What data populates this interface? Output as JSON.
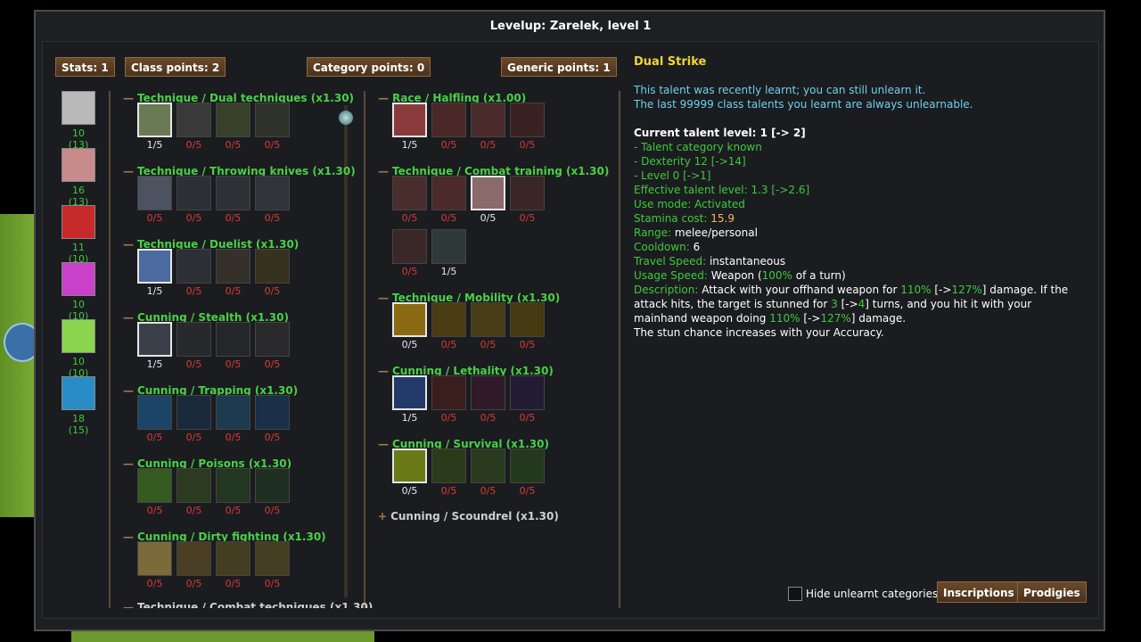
{
  "window": {
    "title": "Levelup: Zarelek, level 1"
  },
  "points": {
    "stats": "Stats: 1",
    "class": "Class points: 2",
    "category": "Category points: 0",
    "generic": "Generic points: 1"
  },
  "stats": [
    {
      "name": "strength-icon",
      "value": "10 (13)",
      "color": "#b9b9b9"
    },
    {
      "name": "dexterity-icon",
      "value": "16 (13)",
      "color": "#c78b8b"
    },
    {
      "name": "constitution-icon",
      "value": "11 (10)",
      "color": "#c62a2a"
    },
    {
      "name": "magic-icon",
      "value": "10 (10)",
      "color": "#c940c9"
    },
    {
      "name": "willpower-icon",
      "value": "10 (10)",
      "color": "#8bd450"
    },
    {
      "name": "cunning-icon",
      "value": "18 (15)",
      "color": "#2a8cc6"
    }
  ],
  "left_categories": [
    {
      "name": "Technique / Dual techniques (x1.30)",
      "talents": [
        {
          "icon": "dual-strike-icon",
          "value": "1/5",
          "learned": true,
          "color": "#6a7a54"
        },
        {
          "icon": "flurry-icon",
          "value": "0/5",
          "learned": false,
          "color": "#3a3a3a"
        },
        {
          "icon": "sweep-icon",
          "value": "0/5",
          "learned": false,
          "color": "#38402a"
        },
        {
          "icon": "whirlwind-icon",
          "value": "0/5",
          "learned": false,
          "color": "#2f332a"
        }
      ]
    },
    {
      "name": "Technique / Throwing knives (x1.30)",
      "talents": [
        {
          "icon": "throwing-knife-icon",
          "value": "0/5",
          "learned": false,
          "color": "#4c5260"
        },
        {
          "icon": "fan-of-knives-icon",
          "value": "0/5",
          "learned": false,
          "color": "#2d2f36"
        },
        {
          "icon": "venom-knife-icon",
          "value": "0/5",
          "learned": false,
          "color": "#2e3136"
        },
        {
          "icon": "knife-storm-icon",
          "value": "0/5",
          "learned": false,
          "color": "#30333a"
        }
      ]
    },
    {
      "name": "Technique / Duelist (x1.30)",
      "talents": [
        {
          "icon": "parry-icon",
          "value": "1/5",
          "learned": true,
          "color": "#4a6aa0"
        },
        {
          "icon": "tempo-icon",
          "value": "0/5",
          "learned": false,
          "color": "#2d2f36"
        },
        {
          "icon": "feint-icon",
          "value": "0/5",
          "learned": false,
          "color": "#35302a"
        },
        {
          "icon": "lunge-icon",
          "value": "0/5",
          "learned": false,
          "color": "#36321f"
        }
      ]
    },
    {
      "name": "Cunning / Stealth (x1.30)",
      "talents": [
        {
          "icon": "stealth-icon",
          "value": "1/5",
          "learned": true,
          "color": "#3a3f4a"
        },
        {
          "icon": "shadowstrike-icon",
          "value": "0/5",
          "learned": false,
          "color": "#27292d"
        },
        {
          "icon": "hide-in-plain-sight-icon",
          "value": "0/5",
          "learned": false,
          "color": "#26272a"
        },
        {
          "icon": "unseen-actions-icon",
          "value": "0/5",
          "learned": false,
          "color": "#2a2a2c"
        }
      ]
    },
    {
      "name": "Cunning / Trapping (x1.30)",
      "talents": [
        {
          "icon": "trap-mastery-icon",
          "value": "0/5",
          "learned": false,
          "color": "#1c4466"
        },
        {
          "icon": "lure-icon",
          "value": "0/5",
          "learned": false,
          "color": "#1a2a3a"
        },
        {
          "icon": "advanced-trap-icon",
          "value": "0/5",
          "learned": false,
          "color": "#1e3a4f"
        },
        {
          "icon": "trap-launcher-icon",
          "value": "0/5",
          "learned": false,
          "color": "#1a2f48"
        }
      ]
    },
    {
      "name": "Cunning / Poisons (x1.30)",
      "talents": [
        {
          "icon": "apply-poison-icon",
          "value": "0/5",
          "learned": false,
          "color": "#355a20"
        },
        {
          "icon": "toxic-death-icon",
          "value": "0/5",
          "learned": false,
          "color": "#2d3a22"
        },
        {
          "icon": "vile-poisons-icon",
          "value": "0/5",
          "learned": false,
          "color": "#223622"
        },
        {
          "icon": "venomous-strike-icon",
          "value": "0/5",
          "learned": false,
          "color": "#1f2f22"
        }
      ]
    },
    {
      "name": "Cunning / Dirty fighting (x1.30)",
      "talents": [
        {
          "icon": "dirty-fighting-icon",
          "value": "0/5",
          "learned": false,
          "color": "#7b6a3a"
        },
        {
          "icon": "cripple-icon",
          "value": "0/5",
          "learned": false,
          "color": "#4a3e24"
        },
        {
          "icon": "disable-icon",
          "value": "0/5",
          "learned": false,
          "color": "#443d22"
        },
        {
          "icon": "hamstring-icon",
          "value": "0/5",
          "learned": false,
          "color": "#463e22"
        }
      ]
    }
  ],
  "left_cut_category": "Technique / Combat techniques (x1.30)",
  "right_categories": [
    {
      "name": "Race / Halfling (x1.00)",
      "talents": [
        {
          "icon": "halfling-luck-icon",
          "value": "1/5",
          "learned": true,
          "color": "#8a3a3a"
        },
        {
          "icon": "duck-and-dodge-icon",
          "value": "0/5",
          "learned": false,
          "color": "#4a2828"
        },
        {
          "icon": "militant-mind-icon",
          "value": "0/5",
          "learned": false,
          "color": "#4a2a2a"
        },
        {
          "icon": "indomitable-icon",
          "value": "0/5",
          "learned": false,
          "color": "#3a2222"
        }
      ]
    },
    {
      "name": "Technique / Combat training (x1.30)",
      "talents": [
        {
          "icon": "thick-skin-icon",
          "value": "0/5",
          "learned": false,
          "color": "#4a2e2e"
        },
        {
          "icon": "armour-training-icon",
          "value": "0/5",
          "learned": false,
          "color": "#4a2a2a"
        },
        {
          "icon": "light-armour-icon",
          "value": "0/5",
          "learned": true,
          "color": "#8a6a6a"
        },
        {
          "icon": "combat-accuracy-icon",
          "value": "0/5",
          "learned": false,
          "color": "#3a2626"
        },
        {
          "icon": "weapons-mastery-icon",
          "value": "0/5",
          "learned": false,
          "color": "#3a2828"
        },
        {
          "icon": "knife-mastery-icon",
          "value": "1/5",
          "learned": false,
          "color": "#2f3a38"
        }
      ]
    },
    {
      "name": "Technique / Mobility (x1.30)",
      "talents": [
        {
          "icon": "disengage-icon",
          "value": "0/5",
          "learned": true,
          "color": "#8a6a12"
        },
        {
          "icon": "evasion-icon",
          "value": "0/5",
          "learned": false,
          "color": "#4a3d14"
        },
        {
          "icon": "tumble-icon",
          "value": "0/5",
          "learned": false,
          "color": "#473c15"
        },
        {
          "icon": "trained-reactions-icon",
          "value": "0/5",
          "learned": false,
          "color": "#463a12"
        }
      ]
    },
    {
      "name": "Cunning / Lethality (x1.30)",
      "talents": [
        {
          "icon": "lethality-icon",
          "value": "1/5",
          "learned": true,
          "color": "#223a6a"
        },
        {
          "icon": "deadly-strikes-icon",
          "value": "0/5",
          "learned": false,
          "color": "#3a1e1e"
        },
        {
          "icon": "willful-combat-icon",
          "value": "0/5",
          "learned": false,
          "color": "#301a2a"
        },
        {
          "icon": "snap-icon",
          "value": "0/5",
          "learned": false,
          "color": "#231b33"
        }
      ]
    },
    {
      "name": "Cunning / Survival (x1.30)",
      "talents": [
        {
          "icon": "heightened-senses-icon",
          "value": "0/5",
          "learned": true,
          "color": "#6a7a16"
        },
        {
          "icon": "device-mastery-icon",
          "value": "0/5",
          "learned": false,
          "color": "#2c3a1c"
        },
        {
          "icon": "track-icon",
          "value": "0/5",
          "learned": false,
          "color": "#2a3a1f"
        },
        {
          "icon": "danger-sense-icon",
          "value": "0/5",
          "learned": false,
          "color": "#24381d"
        }
      ]
    }
  ],
  "right_collapsed_category": "Cunning / Scoundrel (x1.30)",
  "details": {
    "talent_name": "Dual Strike",
    "recent_1": "This talent was recently learnt; you can still unlearn it.",
    "recent_2": "The last 99999 class talents you learnt are always unlearnable.",
    "current_level": "Current talent level: 1 [-> 2]",
    "req_1": "- Talent category known",
    "req_2": "- Dexterity 12 [->14]",
    "req_3": "- Level 0 [->1]",
    "effective_label": "Effective talent level: ",
    "effective_value": "1.3 [->2.6]",
    "use_mode_label": "Use mode: ",
    "use_mode_value": "Activated",
    "stamina_label": "Stamina cost: ",
    "stamina_value": "15.9",
    "range_label": "Range: ",
    "range_value": "melee/personal",
    "cooldown_label": "Cooldown: ",
    "cooldown_value": "6",
    "travel_label": "Travel Speed: ",
    "travel_value": "instantaneous",
    "usage_label": "Usage Speed: ",
    "usage_value_a": "Weapon (",
    "usage_value_pct": "100%",
    "usage_value_b": " of a turn)",
    "desc_label": "Description: ",
    "desc_1a": "Attack with your offhand weapon for ",
    "desc_1b": "110%",
    "desc_1c": " [->",
    "desc_1d": "127%",
    "desc_1e": "] damage. If the",
    "desc_2a": "attack hits, the target is stunned for ",
    "desc_2b": "3",
    "desc_2c": " [->",
    "desc_2d": "4",
    "desc_2e": "] turns, and you hit it with your",
    "desc_3a": "mainhand weapon doing ",
    "desc_3b": "110%",
    "desc_3c": " [->",
    "desc_3d": "127%",
    "desc_3e": "] damage.",
    "desc_4": "The stun chance increases with your Accuracy."
  },
  "footer": {
    "hide_label": "Hide unlearnt categories",
    "inscriptions": "Inscriptions",
    "prodigies": "Prodigies"
  }
}
